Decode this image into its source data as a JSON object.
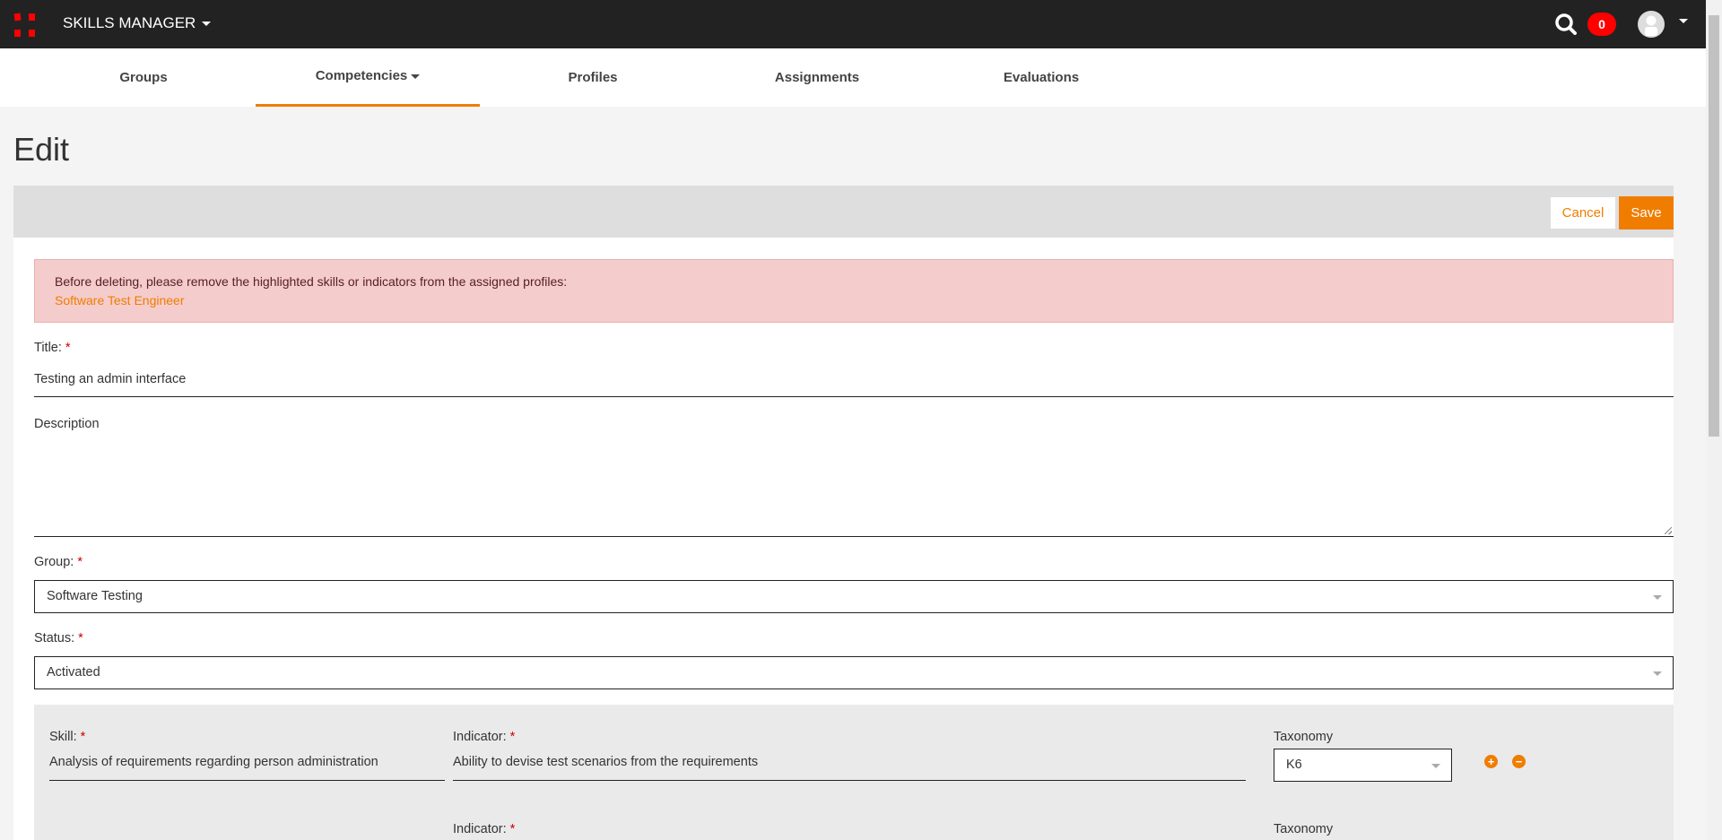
{
  "header": {
    "app_name": "SKILLS MANAGER",
    "notification_count": "0"
  },
  "nav": {
    "tabs": [
      {
        "label": "Groups"
      },
      {
        "label": "Competencies"
      },
      {
        "label": "Profiles"
      },
      {
        "label": "Assignments"
      },
      {
        "label": "Evaluations"
      }
    ],
    "active": "Competencies"
  },
  "page": {
    "title": "Edit"
  },
  "toolbar": {
    "cancel_label": "Cancel",
    "save_label": "Save"
  },
  "alert": {
    "message": "Before deleting, please remove the highlighted skills or indicators from the assigned profiles:",
    "link": "Software Test Engineer"
  },
  "form": {
    "title_label": "Title:",
    "title_value": "Testing an admin interface",
    "description_label": "Description",
    "description_value": "",
    "group_label": "Group:",
    "group_value": "Software Testing",
    "status_label": "Status:",
    "status_value": "Activated",
    "required_mark": "*"
  },
  "skills": {
    "skill_label": "Skill:",
    "indicator_label": "Indicator:",
    "taxonomy_label": "Taxonomy",
    "rows": [
      {
        "skill": "Analysis of requirements regarding person administration",
        "indicator": "Ability to devise test scenarios from the requirements",
        "taxonomy": "K6"
      }
    ],
    "add_symbol": "+",
    "remove_symbol": "−"
  },
  "colors": {
    "accent": "#f07d00",
    "header": "#222222",
    "alert_bg": "#f4cccc",
    "badge": "#ff0000"
  }
}
